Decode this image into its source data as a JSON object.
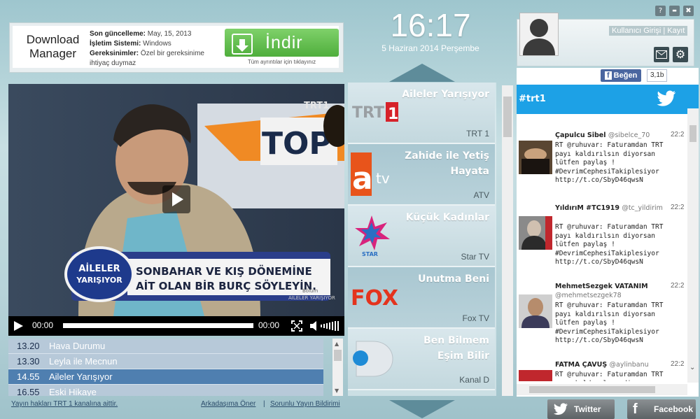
{
  "window": {
    "help": "?",
    "minimize": "▬",
    "close": "✖"
  },
  "ad": {
    "brand_line1": "Download",
    "brand_line2": "Manager",
    "updated_label": "Son güncelleme:",
    "updated_value": "May, 15, 2013",
    "os_label": "İşletim Sistemi:",
    "os_value": "Windows",
    "req_label": "Gereksinimler:",
    "req_value": "Özel bir gereksinime ihtiyaç duymaz",
    "download_label": "İndir",
    "details_link": "Tüm ayrıntılar için tıklayınız"
  },
  "clock": {
    "time": "16:17",
    "date": "5 Haziran 2014 Perşembe"
  },
  "user": {
    "login": "Kullanıcı Girişi | Kayıt"
  },
  "facebook_like": {
    "label": "Beğen",
    "count": "3,1b"
  },
  "video": {
    "channel_bug": "TRT1",
    "screen_tag": "TOP",
    "show_logo_line1": "AİLELER",
    "show_logo_line2": "YARIŞIYOR",
    "caption_line1": "SONBAHAR VE KIŞ DÖNEMİNE",
    "caption_line2": "AİT OLAN BİR BURÇ SÖYLEYİN.",
    "caption_side_1": "Bölüm",
    "caption_side_2": "AİLELER YARIŞIYOR",
    "time_current": "00:00",
    "time_total": "00:00"
  },
  "schedule": [
    {
      "time": "13.20",
      "title": "Hava Durumu"
    },
    {
      "time": "13.30",
      "title": "Leyla ile Mecnun"
    },
    {
      "time": "14.55",
      "title": "Aileler Yarışıyor"
    },
    {
      "time": "16.55",
      "title": "Eski Hikaye"
    }
  ],
  "footer": {
    "rights": "Yayın hakları TRT 1 kanalına aittir.",
    "recommend": "Arkadaşıma Öner",
    "separator": "|",
    "report": "Sorunlu Yayın Bildirimi"
  },
  "channels": [
    {
      "program": "Aileler Yarışıyor",
      "network": "TRT 1",
      "logo": "trt1-logo"
    },
    {
      "program": "Zahide ile Yetiş Hayata",
      "network": "ATV",
      "logo": "atv-logo"
    },
    {
      "program": "Küçük Kadınlar",
      "network": "Star TV",
      "logo": "star-logo"
    },
    {
      "program": "Unutma Beni",
      "network": "Fox TV",
      "logo": "fox-logo"
    },
    {
      "program": "Ben Bilmem Eşim Bilir",
      "network": "Kanal D",
      "logo": "kanald-logo"
    }
  ],
  "logos": {
    "trt": "TRT",
    "one": "1",
    "atv_a": "a",
    "atv_tv": "tv",
    "star": "STAR",
    "fox": "FOX"
  },
  "twitter": {
    "hashtag": "#trt1",
    "tweets": [
      {
        "name": "Çapulcu Sibel",
        "handle": "@sibelce_70",
        "time": "22:2",
        "text": "RT @ruhuvar: Faturamdan TRT payı kaldırılsın diyorsan lütfen paylaş ! #DevrimCephesiTakiplesiyor http://t.co/SbyD46qwsN"
      },
      {
        "name": "YıldırıM #TC1919",
        "handle": "@tc_yildirim",
        "time": "22:2",
        "text": "RT @ruhuvar: Faturamdan TRT payı kaldırılsın diyorsan lütfen paylaş ! #DevrimCephesiTakiplesiyor http://t.co/SbyD46qwsN"
      },
      {
        "name": "MehmetSezgek VATANIM",
        "handle": "@mehmetsezgek78",
        "time": "22:2",
        "text": "RT @ruhuvar: Faturamdan TRT payı kaldırılsın diyorsan lütfen paylaş ! #DevrimCephesiTakiplesiyor http://t.co/SbyD46qwsN"
      },
      {
        "name": "FATMA ÇAVUŞ",
        "handle": "@aylinbanu",
        "time": "22:2",
        "text": "RT @ruhuvar: Faturamdan TRT payı kaldırılsın diyorsan"
      }
    ]
  },
  "share": {
    "twitter": "Twitter",
    "facebook": "Facebook"
  },
  "colors": {
    "accent_blue": "#4f7fb0",
    "download_green": "#5cbf47",
    "twitter_blue": "#1da1e6",
    "facebook_blue": "#3b5998"
  }
}
